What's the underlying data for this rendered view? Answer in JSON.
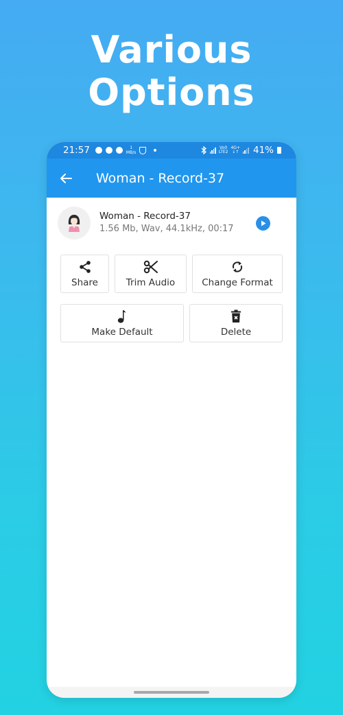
{
  "promo": {
    "headline_line1": "Various",
    "headline_line2": "Options"
  },
  "status_bar": {
    "time": "21:57",
    "notification_icons": [
      "messenger-icon",
      "messenger-icon",
      "facebook-icon",
      "network-speed-icon",
      "shield-icon",
      "dot-icon"
    ],
    "net_speed": "1",
    "net_speed_unit": "MB/s",
    "right_icons": [
      "bluetooth-icon",
      "signal-icon",
      "volte-icon",
      "4g-icon",
      "signal-icon",
      "battery-icon"
    ],
    "volte_label": "Vo0",
    "lte_label": "LTE2",
    "network_label": "4G+",
    "battery": "41%"
  },
  "app_bar": {
    "title": "Woman - Record-37",
    "back_icon": "arrow-left-icon"
  },
  "record": {
    "name": "Woman - Record-37",
    "meta": "1.56 Mb, Wav, 44.1kHz, 00:17",
    "avatar_icon": "woman-avatar-icon",
    "play_icon": "play-icon"
  },
  "options": {
    "row1": [
      {
        "label": "Share",
        "icon": "share-icon"
      },
      {
        "label": "Trim Audio",
        "icon": "scissors-icon"
      },
      {
        "label": "Change Format",
        "icon": "sync-icon"
      }
    ],
    "row2": [
      {
        "label": "Make Default",
        "icon": "music-note-icon"
      },
      {
        "label": "Delete",
        "icon": "trash-icon"
      }
    ]
  },
  "colors": {
    "accent": "#2196ee",
    "status_bar": "#1e87df",
    "play_button": "#2a8fe8",
    "background_top": "#45abf2",
    "background_bottom": "#22d2e2"
  }
}
